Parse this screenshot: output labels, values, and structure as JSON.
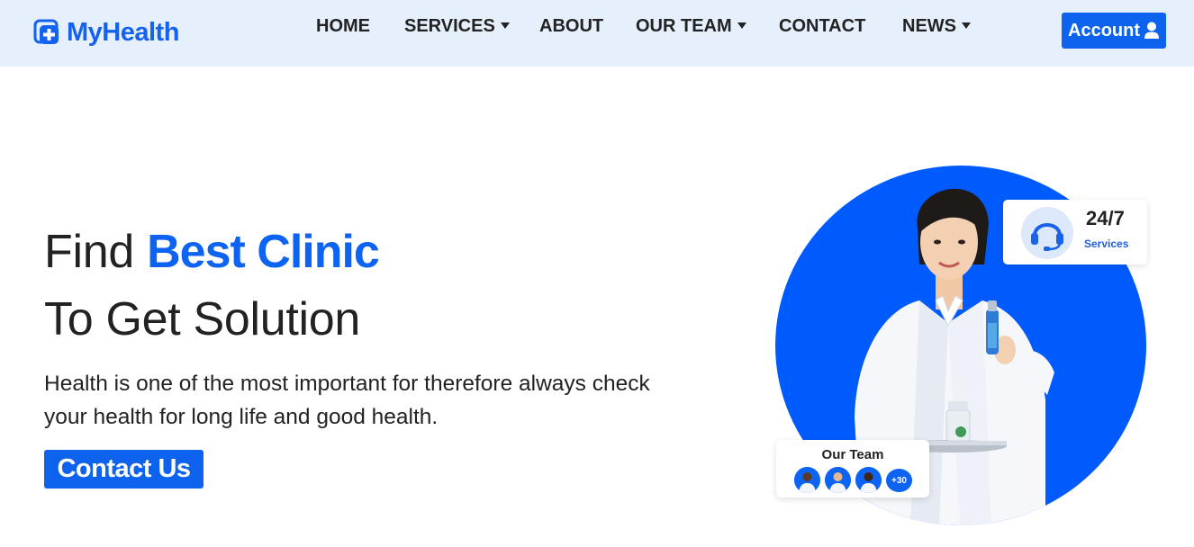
{
  "navbar": {
    "brand": "MyHealth",
    "items": [
      {
        "label": "HOME",
        "has_dropdown": false
      },
      {
        "label": "SERVICES",
        "has_dropdown": true
      },
      {
        "label": "ABOUT",
        "has_dropdown": false
      },
      {
        "label": "OUR TEAM",
        "has_dropdown": true
      },
      {
        "label": "CONTACT",
        "has_dropdown": false
      },
      {
        "label": "NEWS",
        "has_dropdown": true
      }
    ],
    "account_label": "Account",
    "account_icon": "user-icon"
  },
  "hero": {
    "title_part1": "Find ",
    "title_highlight": "Best Clinic",
    "title_line2": "To Get Solution",
    "description": "Health is one of the most important for therefore always check your health for long life and good health.",
    "cta_label": "Contact Us"
  },
  "cards": {
    "services": {
      "value": "24/7",
      "label": "Services",
      "icon": "headset-icon"
    },
    "team": {
      "title": "Our Team",
      "more_count": "+30"
    }
  },
  "colors": {
    "primary": "#0e63ee",
    "navbar_bg": "#e6effc",
    "text": "#222222",
    "circle": "#005bff"
  }
}
